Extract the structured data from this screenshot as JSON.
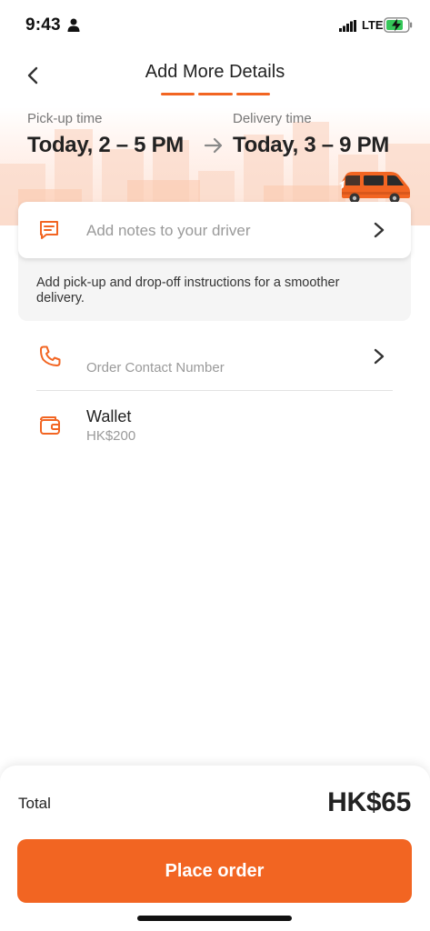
{
  "status_bar": {
    "time": "9:43",
    "network": "LTE",
    "icons": [
      "person-icon",
      "signal-icon",
      "battery-charging-icon"
    ]
  },
  "header": {
    "title": "Add More Details",
    "progress_steps": 3
  },
  "schedule": {
    "pickup": {
      "label": "Pick-up time",
      "value": "Today, 2 – 5 PM"
    },
    "delivery": {
      "label": "Delivery time",
      "value": "Today, 3 – 9 PM"
    }
  },
  "notes": {
    "placeholder": "Add notes to your driver",
    "help": "Add pick-up and drop-off instructions for a smoother delivery."
  },
  "contact": {
    "placeholder": "Order Contact Number"
  },
  "wallet": {
    "title": "Wallet",
    "balance": "HK$200"
  },
  "footer": {
    "total_label": "Total",
    "total_amount": "HK$65",
    "place_order_label": "Place order"
  },
  "colors": {
    "accent": "#f26522",
    "muted_text": "#9a9a9a",
    "primary_text": "#222222"
  }
}
